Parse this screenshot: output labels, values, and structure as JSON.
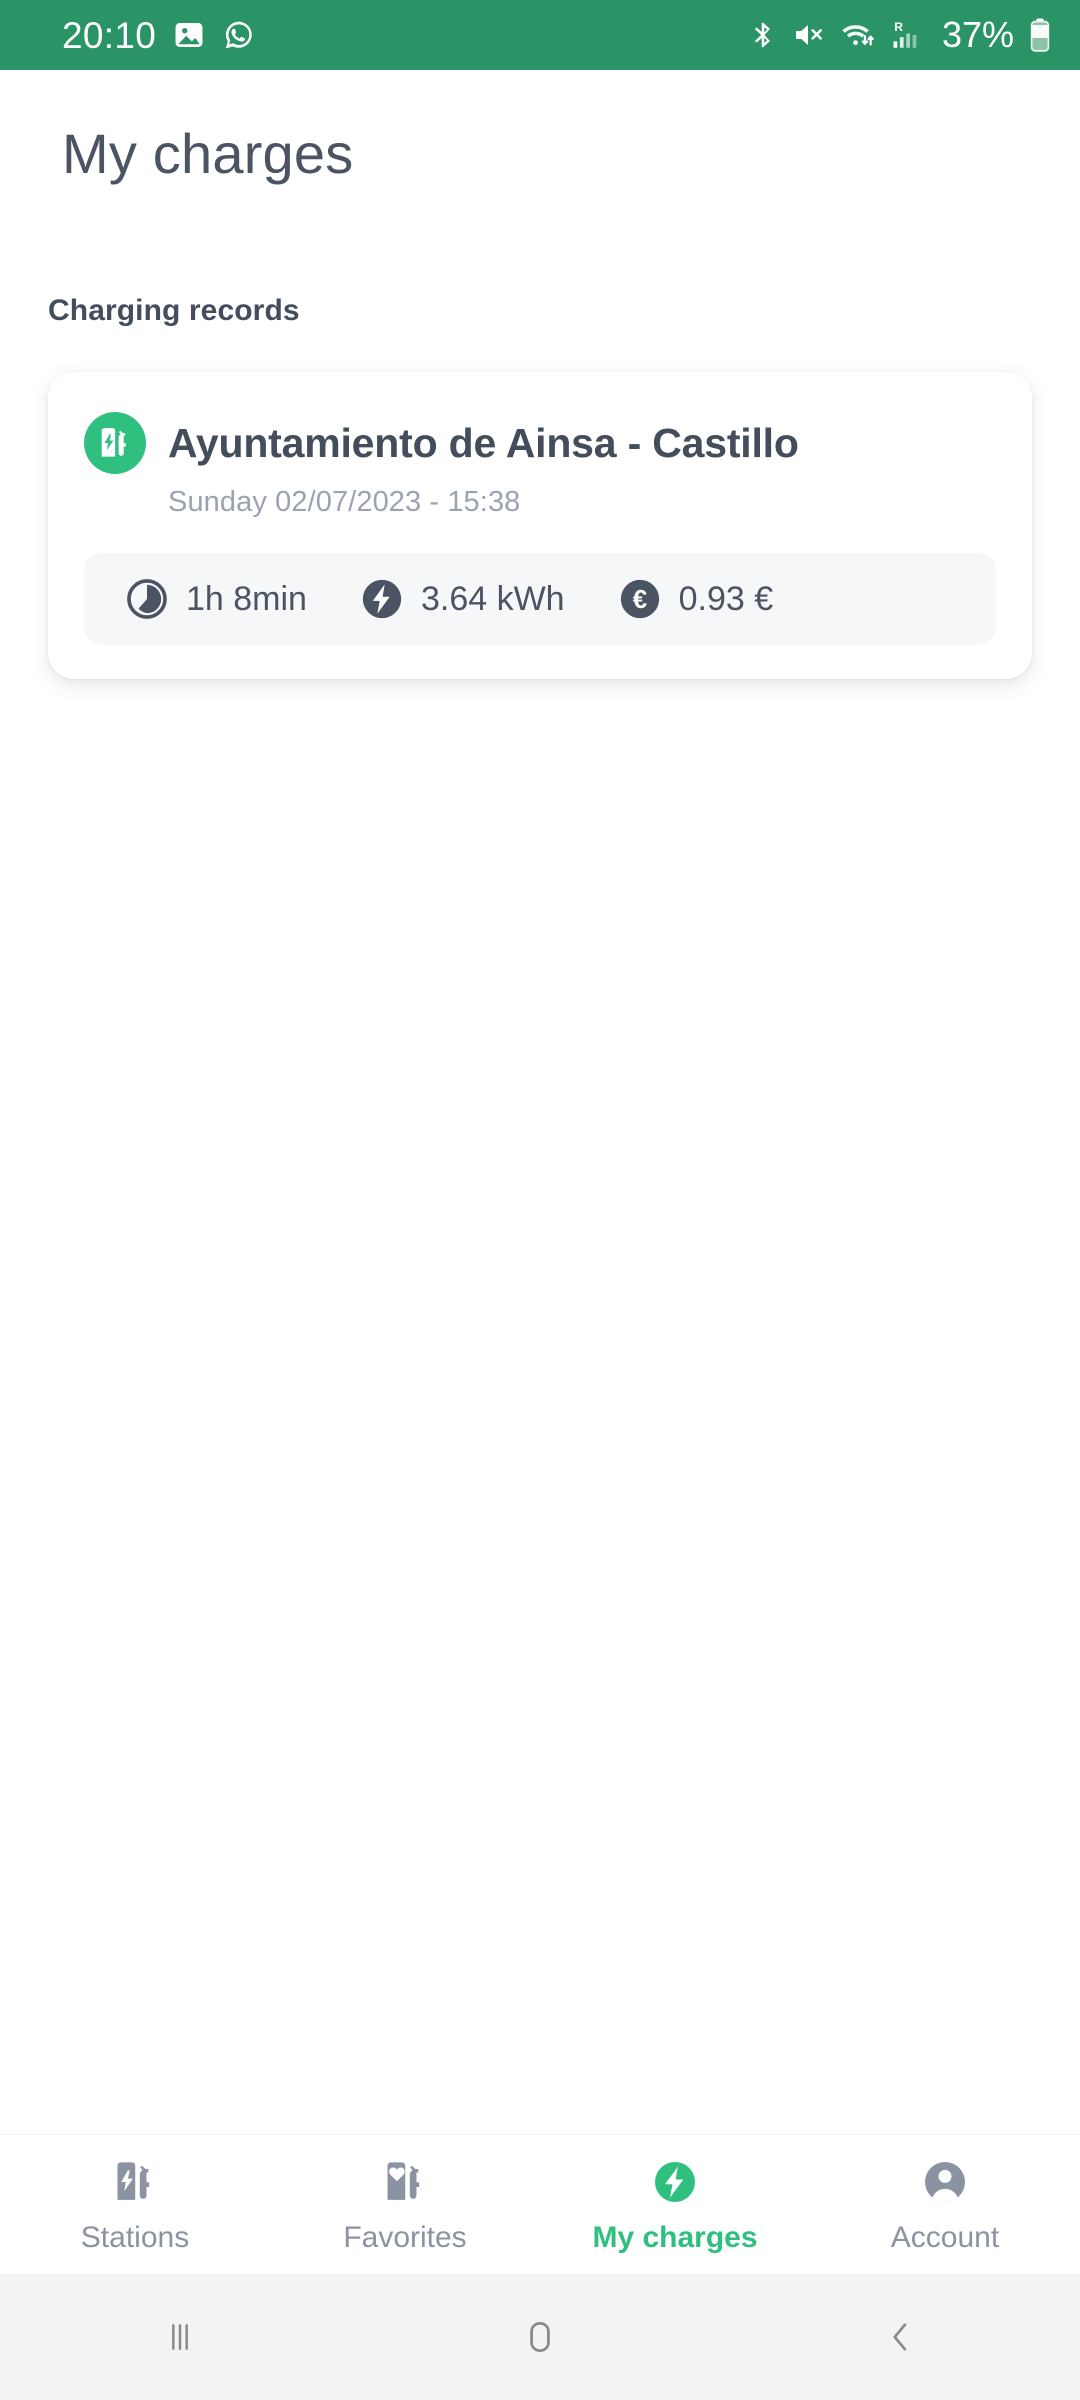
{
  "status_bar": {
    "time": "20:10",
    "battery_percent": "37%",
    "background_color": "#2b9467",
    "left_icons": [
      "gallery-icon",
      "whatsapp-icon"
    ],
    "right_icons": [
      "bluetooth-icon",
      "mute-icon",
      "wifi-icon",
      "signal-roaming-icon",
      "battery-icon"
    ],
    "roaming_label": "R"
  },
  "header": {
    "title": "My charges"
  },
  "main": {
    "section_label": "Charging records",
    "records": [
      {
        "station_icon": "ev-charging-station-icon",
        "station_name": "Ayuntamiento de Ainsa - Castillo",
        "date": "Sunday 02/07/2023 - 15:38",
        "stats": [
          {
            "icon": "clock-icon",
            "value": "1h 8min"
          },
          {
            "icon": "lightning-bolt-icon",
            "value": "3.64 kWh"
          },
          {
            "icon": "euro-icon",
            "value": "0.93 €"
          }
        ]
      }
    ]
  },
  "tabbar": {
    "active_color": "#2fc07f",
    "inactive_color": "#8b93a3",
    "tabs": [
      {
        "label": "Stations",
        "icon": "ev-charging-station-icon",
        "active": false
      },
      {
        "label": "Favorites",
        "icon": "heart-nozzle-icon",
        "active": false
      },
      {
        "label": "My charges",
        "icon": "lightning-bolt-circle-icon",
        "active": true
      },
      {
        "label": "Account",
        "icon": "person-icon",
        "active": false
      }
    ]
  },
  "android_nav": {
    "buttons": [
      {
        "name": "recents-icon"
      },
      {
        "name": "home-icon"
      },
      {
        "name": "back-icon"
      }
    ]
  }
}
